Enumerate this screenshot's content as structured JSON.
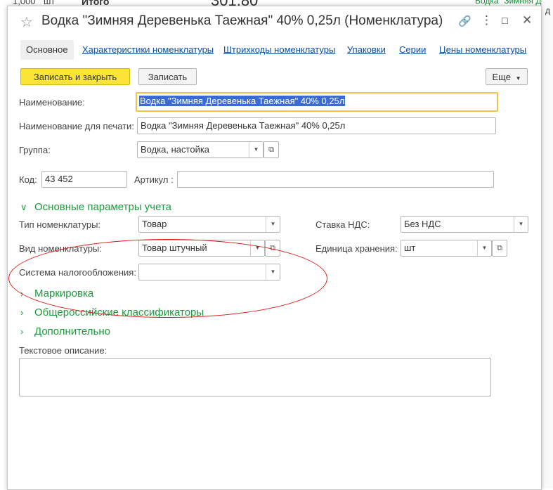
{
  "background": {
    "left_value": "1,000",
    "left_unit": "шт",
    "total_label": "Итого",
    "total_value": "301,80",
    "right_top_text": "Водка \"Зимняя Д",
    "right_side_text": "д"
  },
  "window": {
    "title": "Водка \"Зимняя Деревенька Таежная\" 40% 0,25л (Номенклатура)"
  },
  "tabs": [
    {
      "label": "Основное"
    },
    {
      "label": "Характеристики номенклатуры"
    },
    {
      "label": "Штрихкоды номенклатуры"
    },
    {
      "label": "Упаковки"
    },
    {
      "label": "Серии"
    },
    {
      "label": "Цены номенклатуры"
    }
  ],
  "toolbar": {
    "save_close": "Записать и закрыть",
    "save": "Записать",
    "more": "Еще"
  },
  "form": {
    "name_label": "Наименование:",
    "name_value": "Водка \"Зимняя Деревенька Таежная\" 40% 0,25л",
    "print_name_label": "Наименование для печати:",
    "print_name_value": "Водка \"Зимняя Деревенька Таежная\" 40% 0,25л",
    "group_label": "Группа:",
    "group_value": "Водка, настойка",
    "code_label": "Код:",
    "code_value": "43 452",
    "article_label": "Артикул :",
    "article_value": ""
  },
  "sections": {
    "main_params": "Основные параметры учета",
    "marking": "Маркировка",
    "classifiers": "Общероссийские классификаторы",
    "additional": "Дополнительно"
  },
  "accounting": {
    "type_label": "Тип номенклатуры:",
    "type_value": "Товар",
    "kind_label": "Вид номенклатуры:",
    "kind_value": "Товар штучный",
    "tax_label": "Система налогообложения:",
    "tax_value": "",
    "vat_label": "Ставка НДС:",
    "vat_value": "Без НДС",
    "unit_label": "Единица хранения:",
    "unit_value": "шт"
  },
  "description": {
    "label": "Текстовое описание:",
    "value": ""
  },
  "colors": {
    "accent_green": "#1c9b3c",
    "primary_button": "#fbe338",
    "link_blue": "#0b4da0",
    "annotation_red": "#e01515"
  }
}
